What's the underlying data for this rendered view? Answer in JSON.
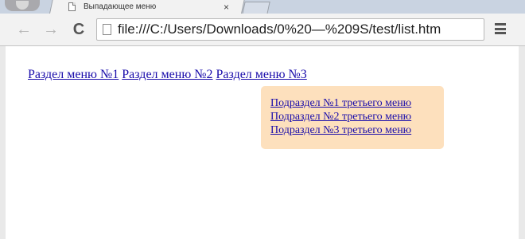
{
  "browser": {
    "tab": {
      "title": "Выпадающее меню",
      "close": "×"
    },
    "nav": {
      "back": "←",
      "forward": "→",
      "reload": "C"
    },
    "address": {
      "url": "file:///C:/Users/Downloads/0%20—%209S/test/list.htm"
    }
  },
  "page": {
    "menu": [
      {
        "label": "Раздел меню №1"
      },
      {
        "label": "Раздел меню №2"
      },
      {
        "label": "Раздел меню №3"
      }
    ],
    "submenu": [
      {
        "label": "Подраздел №1 третьего меню"
      },
      {
        "label": "Подраздел №2 третьего меню"
      },
      {
        "label": "Подраздел №3 третьего меню"
      }
    ]
  },
  "colors": {
    "link": "#1a0dab",
    "dropdown_bg": "#fde0bd"
  }
}
